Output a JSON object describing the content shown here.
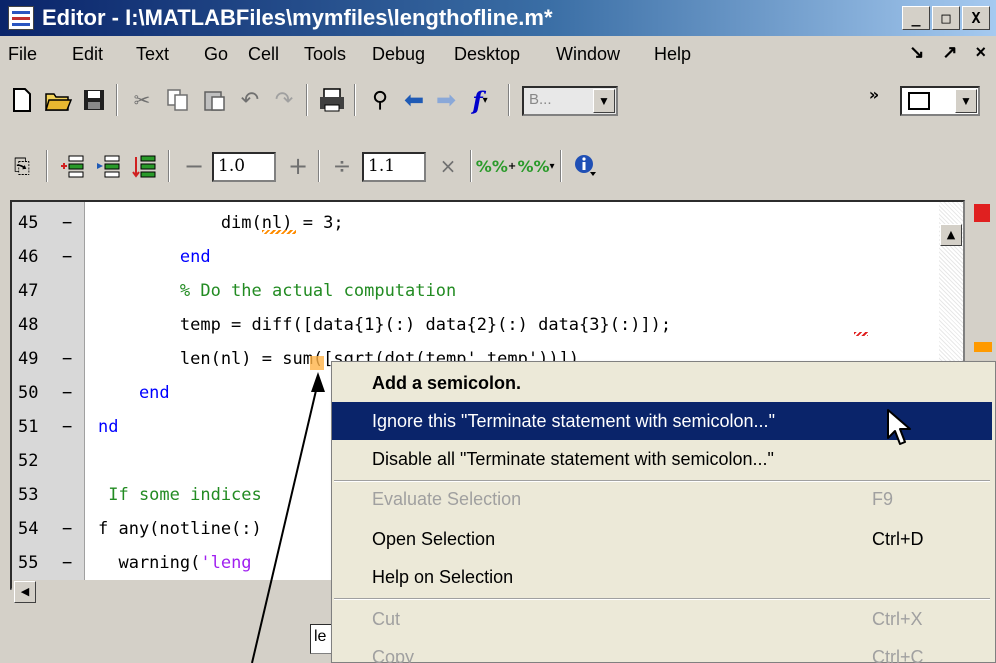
{
  "window": {
    "title": "Editor - I:\\MATLABFiles\\mymfiles\\lengthofline.m*",
    "controls": [
      "_",
      "□",
      "X"
    ]
  },
  "menubar": {
    "items": [
      "File",
      "Edit",
      "Text",
      "Go",
      "Cell",
      "Tools",
      "Debug",
      "Desktop",
      "Window",
      "Help"
    ],
    "right": [
      "↘",
      "↗",
      "×"
    ]
  },
  "toolbar1": {
    "base_combo": "B...",
    "more": "»"
  },
  "toolbar2": {
    "field1": "1.0",
    "field2": "1.1",
    "minus": "−",
    "plus": "+",
    "divide": "÷",
    "times": "×"
  },
  "editor": {
    "lines": [
      {
        "num": "45",
        "dash": "−",
        "text": "dim(nl) = 3;",
        "indent": "            ",
        "kind": "code"
      },
      {
        "num": "46",
        "dash": "−",
        "text": "end",
        "indent": "        ",
        "kind": "kw"
      },
      {
        "num": "47",
        "dash": "",
        "text": "% Do the actual computation",
        "indent": "        ",
        "kind": "comment"
      },
      {
        "num": "48",
        "dash": "",
        "text": "temp = diff([data{1}(:) data{2}(:) data{3}(:)]);",
        "indent": "        ",
        "kind": "code"
      },
      {
        "num": "49",
        "dash": "−",
        "text": "len(nl) = sum([sqrt(dot(temp',temp'))])",
        "indent": "        ",
        "kind": "code"
      },
      {
        "num": "50",
        "dash": "−",
        "text": "end",
        "indent": "    ",
        "kind": "kw"
      },
      {
        "num": "51",
        "dash": "−",
        "text": "nd",
        "indent": "",
        "kind": "kw"
      },
      {
        "num": "52",
        "dash": "",
        "text": "",
        "indent": "",
        "kind": "code"
      },
      {
        "num": "53",
        "dash": "",
        "text": "If some indices",
        "indent": " ",
        "kind": "comment"
      },
      {
        "num": "54",
        "dash": "−",
        "text": "f any(notline(:)",
        "indent": "",
        "kind": "code"
      },
      {
        "num": "55",
        "dash": "−",
        "text": "warning('leng",
        "indent": "  ",
        "kind": "code"
      }
    ]
  },
  "statusbar": {
    "field": "le"
  },
  "context_menu": {
    "items": [
      {
        "label": "Add a semicolon.",
        "shortcut": "",
        "state": "bold"
      },
      {
        "label": "Ignore this \"Terminate statement with semicolon...\"",
        "shortcut": "",
        "state": "highlighted"
      },
      {
        "label": "Disable all \"Terminate statement with semicolon...\"",
        "shortcut": "",
        "state": "normal"
      },
      {
        "label": "Evaluate Selection",
        "shortcut": "F9",
        "state": "disabled"
      },
      {
        "label": "Open Selection",
        "shortcut": "Ctrl+D",
        "state": "normal"
      },
      {
        "label": "Help on Selection",
        "shortcut": "",
        "state": "normal"
      },
      {
        "label": "Cut",
        "shortcut": "Ctrl+X",
        "state": "disabled"
      },
      {
        "label": "Copy",
        "shortcut": "Ctrl+C",
        "state": "disabled"
      }
    ]
  },
  "colors": {
    "title_start": "#0a246a",
    "highlight": "#0a246a",
    "keyword": "#0000ff",
    "comment": "#228b22",
    "warning_marker": "#ff9a00",
    "error_marker": "#e02020"
  }
}
